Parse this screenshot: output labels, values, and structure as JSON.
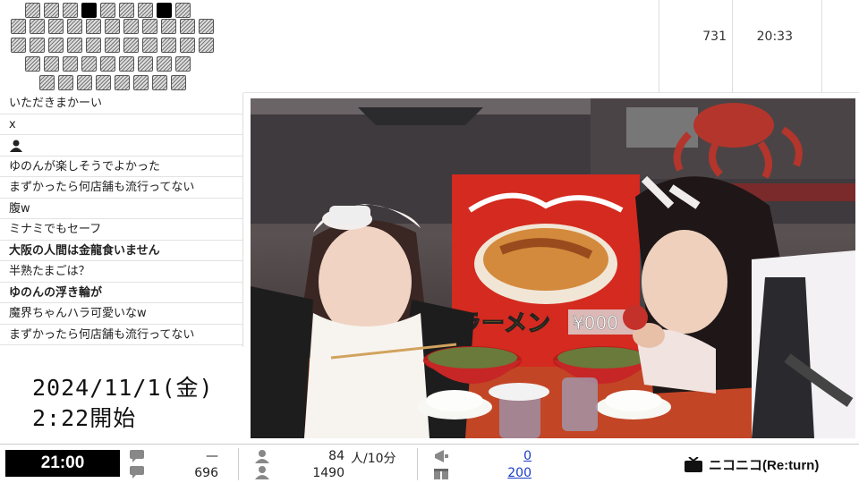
{
  "seats": {
    "rows": [
      {
        "count": 9,
        "filled": [
          3,
          7
        ]
      },
      {
        "count": 11,
        "filled": []
      },
      {
        "count": 11,
        "filled": []
      },
      {
        "count": 9,
        "filled": []
      },
      {
        "count": 8,
        "filled": []
      }
    ]
  },
  "top_stats": {
    "count": "731",
    "time": "20:33"
  },
  "comments": [
    {
      "text": "いただきまかーい",
      "bold": false
    },
    {
      "text": "x",
      "bold": false
    },
    {
      "text": "",
      "bold": false,
      "icon": "person-icon"
    },
    {
      "text": "ゆのんが楽しそうでよかった",
      "bold": false
    },
    {
      "text": "まずかったら何店舗も流行ってない",
      "bold": false
    },
    {
      "text": "腹w",
      "bold": false
    },
    {
      "text": "ミナミでもセーフ",
      "bold": false
    },
    {
      "text": "大阪の人間は金龍食いません",
      "bold": true
    },
    {
      "text": "半熟たまごは？",
      "bold": false
    },
    {
      "text": "ゆのんの浮き輪が",
      "bold": true
    },
    {
      "text": "魔界ちゃんハラ可愛いなw",
      "bold": false
    },
    {
      "text": "まずかったら何店舗も流行ってない",
      "bold": false
    }
  ],
  "date": {
    "line1": "2024/11/1(金)",
    "line2": "2:22開始"
  },
  "video": {
    "sign_text": "ラーメン",
    "price_text": "¥000"
  },
  "bottom": {
    "clock": "21:00",
    "comment_rate": "—",
    "comment_total": "696",
    "viewers_rate": "84",
    "viewers_rate_unit": "人/10分",
    "viewers_total": "1490",
    "ad_points": "0",
    "gift_points": "200",
    "logo": "ニコニコ(Re:turn)"
  },
  "colors": {
    "link": "#1a3cc8",
    "clock_bg": "#000000",
    "sign_red": "#d42a1f"
  }
}
